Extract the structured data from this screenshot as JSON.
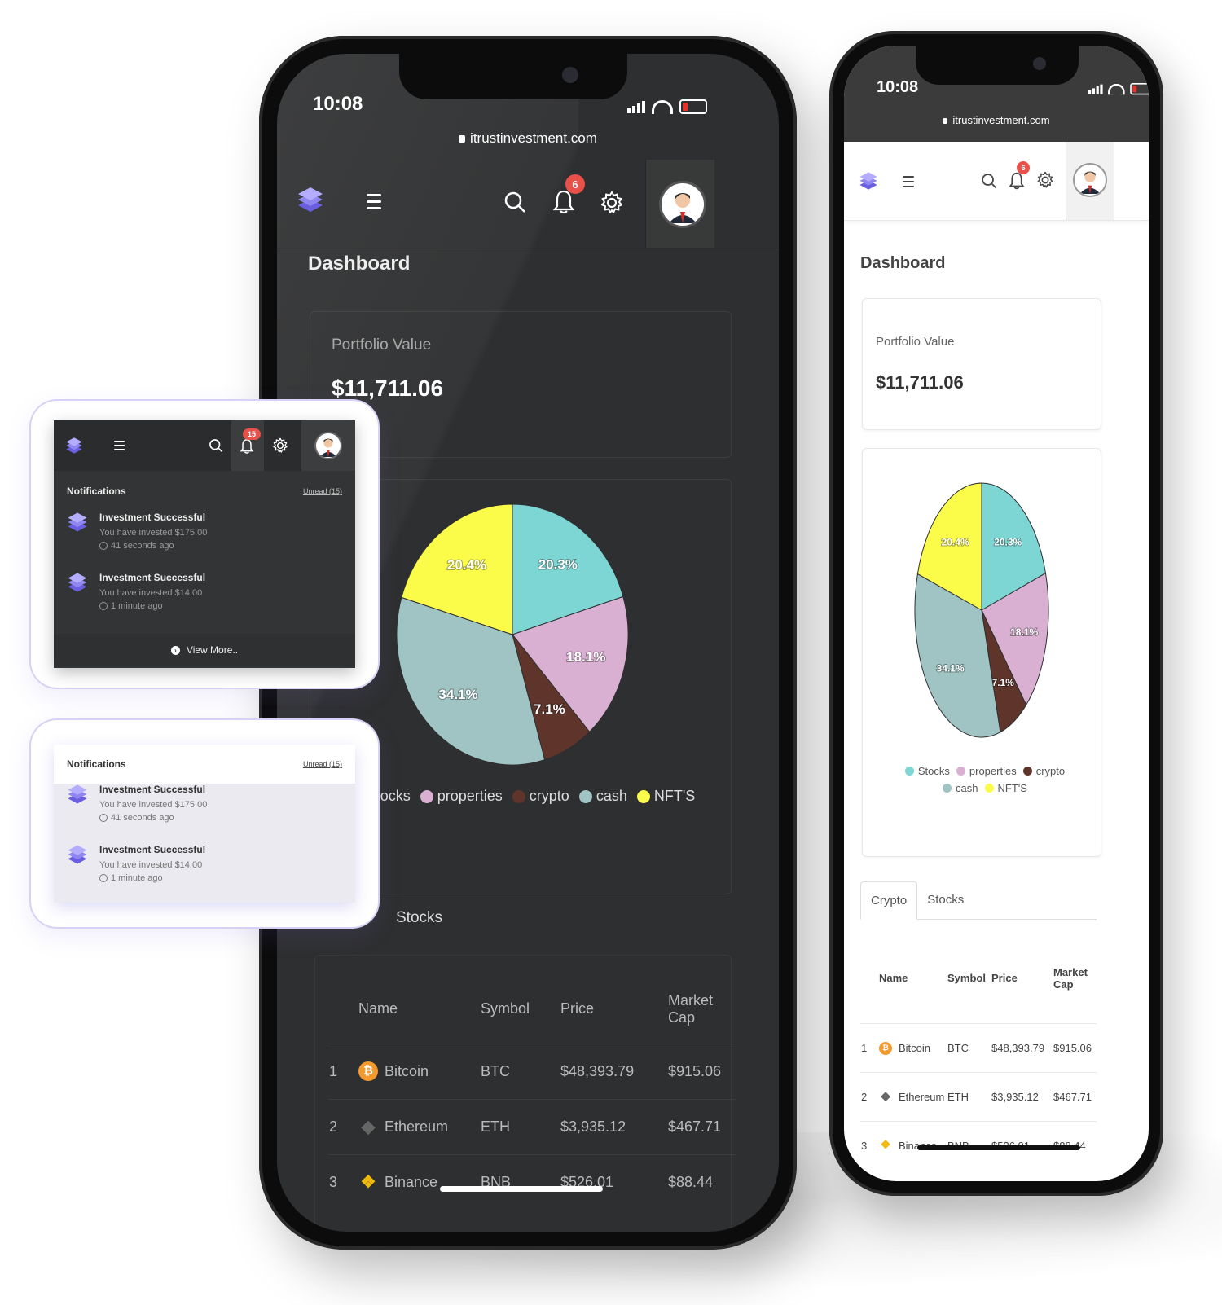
{
  "status_bar": {
    "time": "10:08"
  },
  "browser": {
    "url": "itrustinvestment.com"
  },
  "header": {
    "notification_count": "6",
    "panel_notification_count": "15"
  },
  "page": {
    "title": "Dashboard"
  },
  "portfolio": {
    "label": "Portfolio Value",
    "value": "$11,711.06"
  },
  "chart_data": {
    "type": "pie",
    "slices": [
      {
        "label": "Stocks",
        "value": 20.3,
        "display": "20.3%",
        "color": "#7dd6d4"
      },
      {
        "label": "properties",
        "value": 18.1,
        "display": "18.1%",
        "color": "#d9b0d2"
      },
      {
        "label": "crypto",
        "value": 7.1,
        "display": "7.1%",
        "color": "#5f342b"
      },
      {
        "label": "cash",
        "value": 34.1,
        "display": "34.1%",
        "color": "#9fc4c3"
      },
      {
        "label": "NFT'S",
        "value": 20.4,
        "display": "20.4%",
        "color": "#fbfb4a"
      }
    ]
  },
  "tabs": [
    {
      "label": "Crypto",
      "active": true
    },
    {
      "label": "Stocks",
      "active": false
    }
  ],
  "table": {
    "headers": {
      "name": "Name",
      "symbol": "Symbol",
      "price": "Price",
      "market_cap_1": "Market",
      "market_cap_2": "Cap"
    },
    "rows": [
      {
        "rank": "1",
        "name": "Bitcoin",
        "symbol": "BTC",
        "price": "$48,393.79",
        "market_cap": "$915.06",
        "icon": "bitcoin-icon",
        "color": "#f29a2e"
      },
      {
        "rank": "2",
        "name": "Ethereum",
        "symbol": "ETH",
        "price": "$3,935.12",
        "market_cap": "$467.71",
        "icon": "ethereum-icon",
        "color": "#666666"
      },
      {
        "rank": "3",
        "name": "Binance",
        "symbol": "BNB",
        "price": "$526.01",
        "market_cap": "$88.44",
        "icon": "binance-icon",
        "color": "#f0b90b"
      }
    ]
  },
  "notifications": {
    "title": "Notifications",
    "unread_label": "Unread (15)",
    "items": [
      {
        "title": "Investment Successful",
        "message": "You have invested $175.00",
        "time": "41 seconds ago"
      },
      {
        "title": "Investment Successful",
        "message": "You have invested $14.00",
        "time": "1 minute ago"
      }
    ],
    "view_more": "View More.."
  },
  "colors": {
    "brand_purple": "#8f86f0",
    "dark_bg": "#2e2f30",
    "badge_red": "#e8514a"
  }
}
